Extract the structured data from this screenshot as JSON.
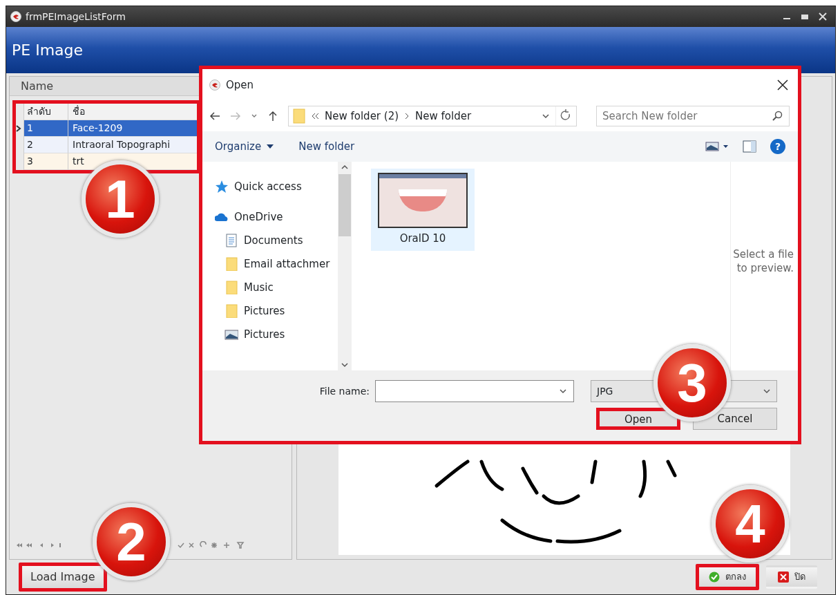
{
  "window": {
    "title": "frmPEImageListForm"
  },
  "header": {
    "title": "PE Image"
  },
  "list_panel": {
    "title": "Name",
    "columns": [
      "ลำดับ",
      "ชื่อ"
    ],
    "rows": [
      {
        "cells": [
          "1",
          "Face-1209"
        ],
        "selected": true
      },
      {
        "cells": [
          "2",
          "Intraoral Topographi"
        ],
        "selected": false
      },
      {
        "cells": [
          "3",
          "trt"
        ],
        "selected": false
      }
    ],
    "highlighted": true
  },
  "load_button": {
    "label": "Load Image",
    "highlighted": true
  },
  "dialog": {
    "title": "Open",
    "path": [
      "New folder (2)",
      "New folder"
    ],
    "search": {
      "placeholder": "Search New folder"
    },
    "toolbar": [
      {
        "label": "Organize",
        "dropdown": true
      },
      {
        "label": "New folder",
        "dropdown": false
      }
    ],
    "nav_items": [
      {
        "label": "Quick access",
        "kind": "star"
      },
      {
        "label": "OneDrive",
        "kind": "cloud"
      },
      {
        "label": "Documents",
        "kind": "document"
      },
      {
        "label": "Email attachmer",
        "kind": "folder"
      },
      {
        "label": "Music",
        "kind": "folder"
      },
      {
        "label": "Pictures",
        "kind": "folder"
      },
      {
        "label": "Pictures",
        "kind": "library"
      }
    ],
    "files": [
      {
        "label": "OralD 10",
        "selected": true
      }
    ],
    "preview_text": "Select a file to preview.",
    "file_name_label": "File name:",
    "file_type": "JPG",
    "help": "?",
    "buttons": [
      {
        "label": "Open",
        "highlighted": true
      },
      {
        "label": "Cancel",
        "highlighted": false
      }
    ]
  },
  "footer_buttons": [
    {
      "label": "ตกลง",
      "kind": "ok",
      "highlighted": true
    },
    {
      "label": "ปิด",
      "kind": "close",
      "highlighted": false
    }
  ],
  "callouts": [
    "1",
    "2",
    "3",
    "4"
  ]
}
